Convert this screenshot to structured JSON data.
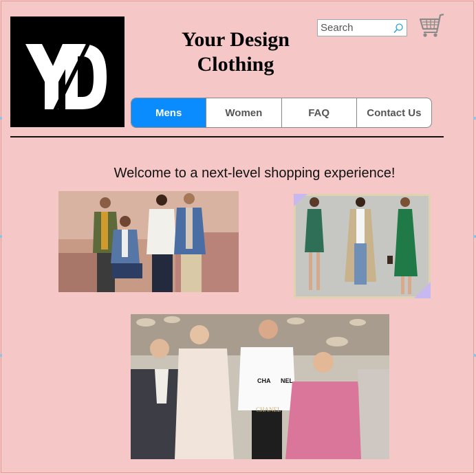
{
  "brand": {
    "logo_text": "YD",
    "title_line1": "Your Design",
    "title_line2": "Clothing"
  },
  "search": {
    "placeholder": "Search",
    "icon": "search-icon"
  },
  "cart": {
    "icon": "cart-icon"
  },
  "nav": {
    "tabs": [
      {
        "label": "Mens",
        "active": true
      },
      {
        "label": "Women",
        "active": false
      },
      {
        "label": "FAQ",
        "active": false
      },
      {
        "label": "Contact Us",
        "active": false
      }
    ]
  },
  "main": {
    "welcome": "Welcome to a next-level shopping experience!",
    "runway_text": [
      "CHA",
      "NEL",
      "CHANEL"
    ]
  },
  "colors": {
    "background": "#f6c7c7",
    "accent": "#0a8cff"
  }
}
